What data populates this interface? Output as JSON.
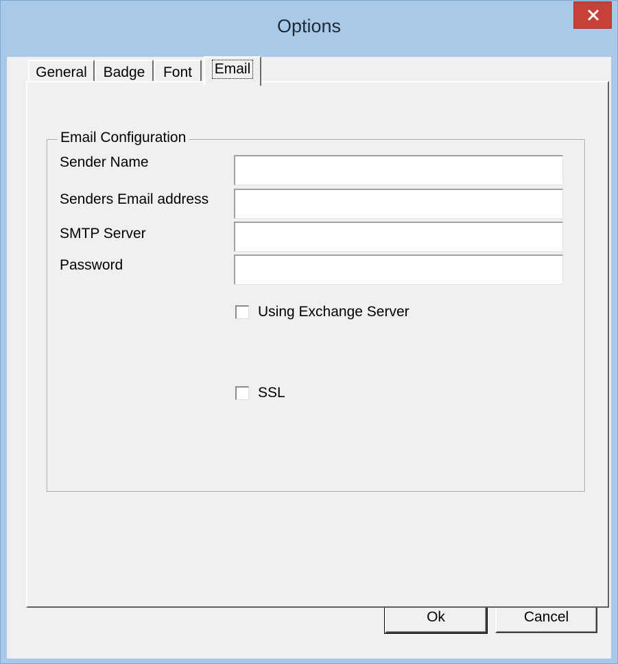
{
  "window": {
    "title": "Options"
  },
  "tabs": [
    {
      "label": "General"
    },
    {
      "label": "Badge"
    },
    {
      "label": "Font"
    },
    {
      "label": "Email"
    }
  ],
  "active_tab": "Email",
  "email_group": {
    "title": "Email Configuration",
    "fields": [
      {
        "label": "Sender Name",
        "value": ""
      },
      {
        "label": "Senders Email address",
        "value": ""
      },
      {
        "label": "SMTP Server",
        "value": ""
      },
      {
        "label": "Password",
        "value": ""
      }
    ],
    "exchange_checkbox": {
      "label": "Using Exchange Server",
      "checked": false
    },
    "ssl_checkbox": {
      "label": "SSL",
      "checked": false
    }
  },
  "buttons": {
    "ok": "Ok",
    "cancel": "Cancel"
  },
  "icons": {
    "close": "close-icon"
  },
  "colors": {
    "titlebar": "#a9c9e8",
    "close_button": "#c7403a",
    "dialog_bg": "#f0f0f0"
  }
}
